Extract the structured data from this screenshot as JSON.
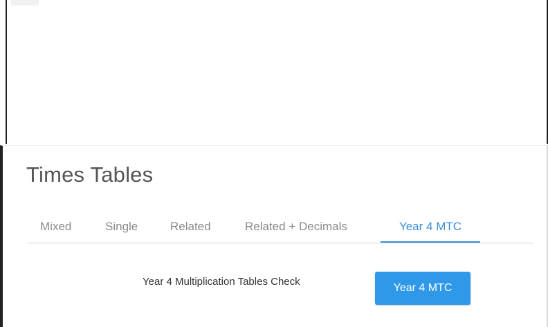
{
  "section": {
    "title": "Times Tables"
  },
  "tabs": [
    {
      "label": "Mixed",
      "active": false
    },
    {
      "label": "Single",
      "active": false
    },
    {
      "label": "Related",
      "active": false
    },
    {
      "label": "Related + Decimals",
      "active": false
    },
    {
      "label": "Year 4 MTC",
      "active": true
    }
  ],
  "content": {
    "description": "Year 4 Multiplication Tables Check",
    "button_label": "Year 4 MTC"
  },
  "colors": {
    "accent": "#2f98e8",
    "active_tab": "#3a8fd8",
    "inactive_tab": "#8a8a8a"
  }
}
